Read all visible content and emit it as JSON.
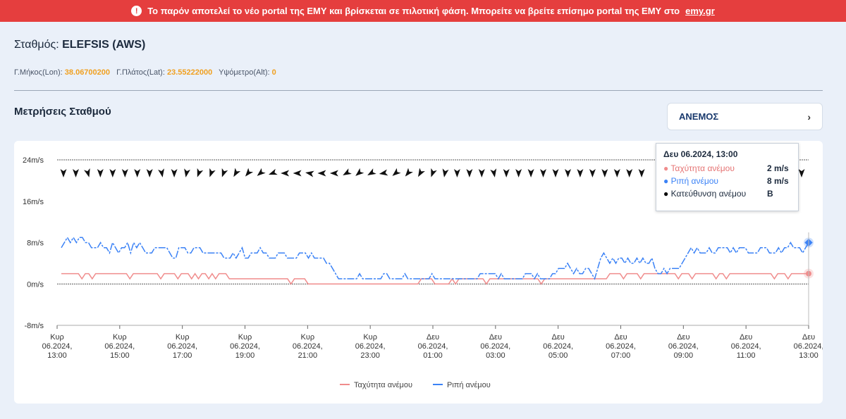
{
  "banner": {
    "text": "Το παρόν αποτελεί το νέο portal της ΕΜΥ και βρίσκεται σε πιλοτική φάση. Μπορείτε να βρείτε επίσημο portal της ΕΜΥ στο",
    "link": "emy.gr",
    "icon": "exclamation-icon"
  },
  "station": {
    "label": "Σταθμός:",
    "name": "ELEFSIS (AWS)",
    "lon_label": "Γ.Μήκος(Lon):",
    "lon": "38.06700200",
    "lat_label": "Γ.Πλάτος(Lat):",
    "lat": "23.55222000",
    "alt_label": "Υψόμετρο(Alt):",
    "alt": "0"
  },
  "section_title": "Μετρήσεις Σταθμού",
  "selector": {
    "label": "ΑΝΕΜΟΣ",
    "icon": "chevron-right-icon"
  },
  "tooltip": {
    "title": "Δευ 06.2024, 13:00",
    "rows": [
      {
        "label": "Ταχύτητα ανέμου",
        "value": "2 m/s",
        "color": "#f08c8c"
      },
      {
        "label": "Ριπή ανέμου",
        "value": "8 m/s",
        "color": "#3b82f6"
      },
      {
        "label": "Κατεύθυνση ανέμου",
        "value": "Β",
        "color": "#000000"
      }
    ]
  },
  "chart_data": {
    "type": "line",
    "y_ticks": [
      {
        "value": -8,
        "label": "-8m/s"
      },
      {
        "value": 0,
        "label": "0m/s"
      },
      {
        "value": 8,
        "label": "8m/s"
      },
      {
        "value": 16,
        "label": "16m/s"
      },
      {
        "value": 24,
        "label": "24m/s"
      }
    ],
    "ylim": [
      -8,
      24
    ],
    "x_ticks": [
      [
        "Κυρ",
        "06.2024,",
        "13:00"
      ],
      [
        "Κυρ",
        "06.2024,",
        "15:00"
      ],
      [
        "Κυρ",
        "06.2024,",
        "17:00"
      ],
      [
        "Κυρ",
        "06.2024,",
        "19:00"
      ],
      [
        "Κυρ",
        "06.2024,",
        "21:00"
      ],
      [
        "Κυρ",
        "06.2024,",
        "23:00"
      ],
      [
        "Δευ",
        "06.2024,",
        "01:00"
      ],
      [
        "Δευ",
        "06.2024,",
        "03:00"
      ],
      [
        "Δευ",
        "06.2024,",
        "05:00"
      ],
      [
        "Δευ",
        "06.2024,",
        "07:00"
      ],
      [
        "Δευ",
        "06.2024,",
        "09:00"
      ],
      [
        "Δευ",
        "06.2024,",
        "11:00"
      ],
      [
        "Δευ",
        "06.2024,",
        "13:00"
      ]
    ],
    "legend": [
      {
        "label": "Ταχύτητα ανέμου",
        "color": "#f08c8c"
      },
      {
        "label": "Ριπή ανέμου",
        "color": "#3b82f6"
      }
    ],
    "legend_position": "bottom",
    "series": [
      {
        "name": "Ταχύτητα ανέμου",
        "color": "#f08c8c",
        "dashed": false,
        "values": [
          2,
          2,
          2,
          2,
          2,
          2,
          1,
          2,
          2,
          1,
          2,
          2,
          2,
          2,
          2,
          2,
          2,
          2,
          2,
          2,
          1,
          2,
          2,
          2,
          2,
          2,
          2,
          2,
          2,
          1,
          2,
          2,
          2,
          2,
          1,
          2,
          2,
          2,
          1,
          2,
          1,
          2,
          2,
          1,
          2,
          1,
          2,
          2,
          2,
          1,
          1,
          1,
          1,
          1,
          1,
          1,
          1,
          1,
          1,
          1,
          1,
          1,
          1,
          1,
          1,
          1,
          1,
          0,
          1,
          1,
          1,
          1,
          0,
          0,
          0,
          0,
          0,
          0,
          0,
          0,
          0,
          0,
          0,
          0,
          0,
          0,
          0,
          0,
          0,
          0,
          0,
          0,
          0,
          0,
          0,
          0,
          0,
          0,
          0,
          0,
          0,
          0,
          0,
          0,
          0,
          1,
          1,
          1,
          1,
          0,
          0,
          0,
          0,
          0,
          1,
          0,
          1,
          1,
          1,
          1,
          1,
          1,
          1,
          1,
          0,
          1,
          1,
          1,
          1,
          1,
          1,
          1,
          1,
          1,
          1,
          1,
          1,
          1,
          1,
          1,
          0,
          1,
          1,
          1,
          1,
          1,
          1,
          1,
          1,
          1,
          1,
          1,
          1,
          1,
          1,
          1,
          1,
          1,
          1,
          1,
          2,
          2,
          2,
          2,
          1,
          2,
          2,
          2,
          2,
          1,
          2,
          2,
          2,
          2,
          2,
          2,
          2,
          2,
          2,
          2,
          1,
          2,
          2,
          2,
          1,
          2,
          2,
          2,
          2,
          2,
          2,
          1,
          2,
          2,
          1,
          2,
          2,
          2,
          2,
          2,
          2,
          2,
          2,
          2,
          2,
          2,
          2,
          2,
          1,
          2,
          2,
          2,
          1,
          2,
          2,
          2,
          2,
          2,
          2
        ]
      },
      {
        "name": "Ριπή ανέμου",
        "color": "#3b82f6",
        "dashed": true,
        "values": [
          7,
          8,
          9,
          8,
          9,
          8,
          9,
          9,
          8,
          8,
          7,
          7,
          7,
          8,
          7,
          7,
          6,
          8,
          7,
          6,
          7,
          7,
          8,
          6,
          8,
          7,
          8,
          7,
          6,
          6,
          6,
          7,
          7,
          7,
          7,
          7,
          6,
          5,
          5,
          7,
          7,
          7,
          6,
          6,
          7,
          7,
          7,
          6,
          6,
          6,
          6,
          6,
          6,
          6,
          5,
          5,
          5,
          6,
          5,
          6,
          7,
          5,
          5,
          6,
          6,
          6,
          7,
          6,
          6,
          5,
          5,
          5,
          6,
          6,
          6,
          5,
          5,
          5,
          5,
          6,
          6,
          6,
          5,
          6,
          5,
          5,
          5,
          5,
          4,
          4,
          3,
          2,
          1,
          1,
          1,
          1,
          1,
          1,
          1,
          2,
          1,
          1,
          1,
          1,
          1,
          1,
          1,
          2,
          2,
          1,
          1,
          1,
          1,
          1,
          2,
          1,
          1,
          1,
          1,
          1,
          1,
          1,
          1,
          2,
          1,
          1,
          1,
          1,
          1,
          1,
          1,
          1,
          1,
          1,
          1,
          1,
          1,
          1,
          1,
          2,
          2,
          2,
          2,
          2,
          2,
          1,
          2,
          1,
          1,
          1,
          1,
          1,
          1,
          1,
          2,
          2,
          2,
          1,
          2,
          1,
          1,
          1,
          1,
          2,
          2,
          3,
          3,
          3,
          4,
          3,
          2,
          3,
          2,
          2,
          3,
          3,
          2,
          1,
          3,
          5,
          6,
          5,
          4,
          5,
          4,
          5,
          5,
          4,
          5,
          4,
          4,
          5,
          4,
          5,
          4,
          4,
          5,
          3,
          2,
          2,
          3,
          2,
          3,
          3,
          3,
          3,
          4,
          5,
          6,
          7,
          6,
          7,
          6,
          6,
          6,
          7,
          6,
          6,
          7,
          7,
          7,
          7,
          6,
          7,
          6,
          7,
          7,
          7,
          6,
          6,
          6,
          6,
          7,
          7,
          7,
          6,
          6,
          6,
          7,
          6,
          7,
          7,
          8,
          7,
          7,
          7,
          6,
          7,
          8
        ]
      }
    ],
    "direction_arrows": [
      180,
      180,
      165,
      180,
      180,
      180,
      180,
      180,
      170,
      180,
      190,
      200,
      200,
      200,
      210,
      220,
      230,
      250,
      270,
      270,
      280,
      270,
      270,
      240,
      230,
      240,
      260,
      230,
      220,
      210,
      200,
      190,
      180,
      180,
      180,
      170,
      180,
      180,
      180,
      180,
      180,
      180,
      180,
      180,
      180,
      180,
      180,
      180,
      180,
      180,
      180,
      180,
      180,
      180,
      180,
      180,
      180,
      180,
      180,
      180,
      180
    ]
  }
}
